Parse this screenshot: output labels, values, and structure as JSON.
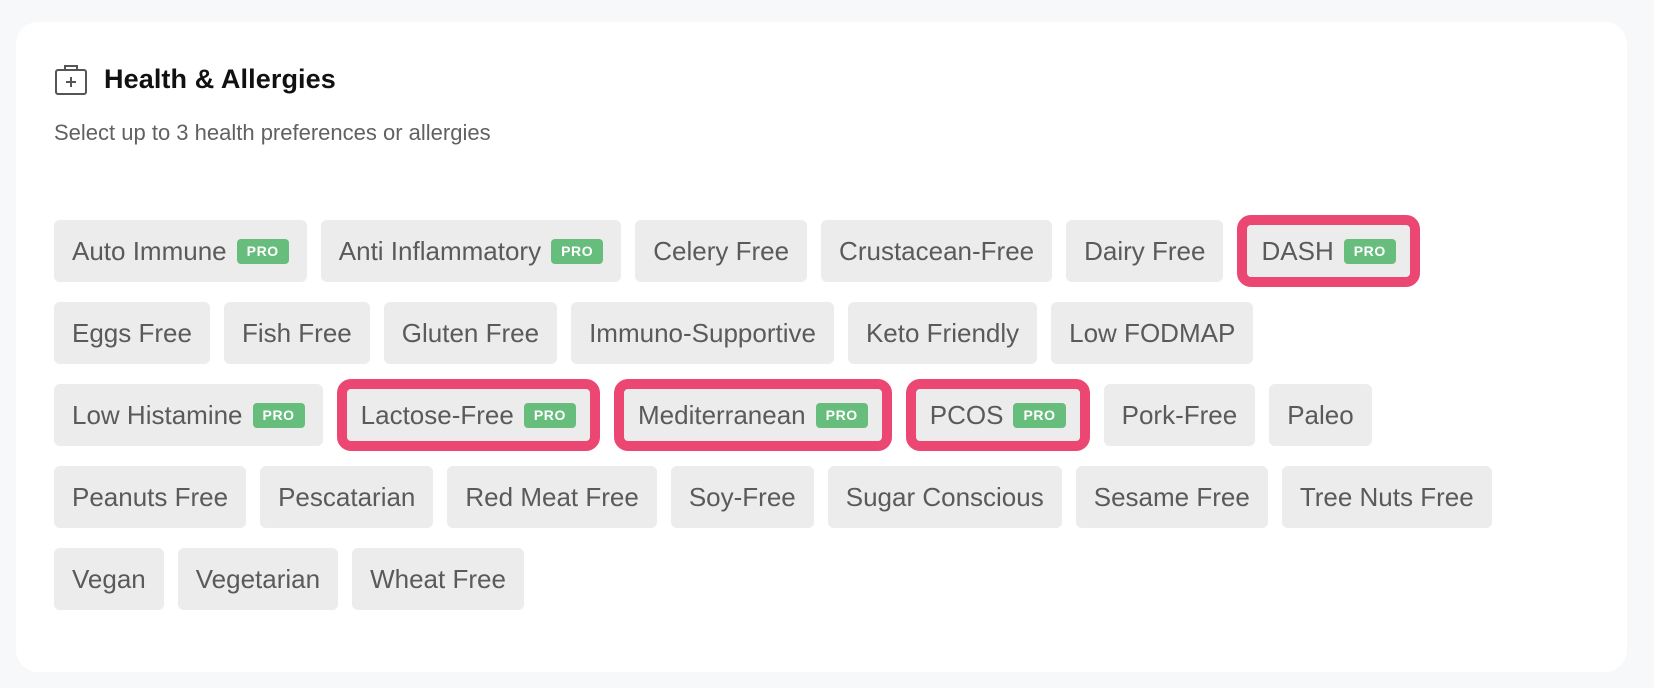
{
  "section": {
    "title": "Health & Allergies",
    "subtitle": "Select up to 3 health preferences or allergies",
    "icon": "medical-kit-icon"
  },
  "colors": {
    "chip_bg": "#ececec",
    "chip_text": "#5a5a5a",
    "pro_badge": "#67bd7c",
    "selected_outline": "#ec4672"
  },
  "rows": [
    [
      {
        "label": "Auto Immune",
        "pro": "PRO",
        "selected": false
      },
      {
        "label": "Anti Inflammatory",
        "pro": "PRO",
        "selected": false
      },
      {
        "label": "Celery Free",
        "pro": null,
        "selected": false
      },
      {
        "label": "Crustacean-Free",
        "pro": null,
        "selected": false
      },
      {
        "label": "Dairy Free",
        "pro": null,
        "selected": false
      },
      {
        "label": "DASH",
        "pro": "PRO",
        "selected": true
      }
    ],
    [
      {
        "label": "Eggs Free",
        "pro": null,
        "selected": false
      },
      {
        "label": "Fish Free",
        "pro": null,
        "selected": false
      },
      {
        "label": "Gluten Free",
        "pro": null,
        "selected": false
      },
      {
        "label": "Immuno-Supportive",
        "pro": null,
        "selected": false
      },
      {
        "label": "Keto Friendly",
        "pro": null,
        "selected": false
      },
      {
        "label": "Low FODMAP",
        "pro": null,
        "selected": false
      }
    ],
    [
      {
        "label": "Low Histamine",
        "pro": "PRO",
        "selected": false
      },
      {
        "label": "Lactose-Free",
        "pro": "PRO",
        "selected": true
      },
      {
        "label": "Mediterranean",
        "pro": "PRO",
        "selected": true
      },
      {
        "label": "PCOS",
        "pro": "PRO",
        "selected": true
      },
      {
        "label": "Pork-Free",
        "pro": null,
        "selected": false
      },
      {
        "label": "Paleo",
        "pro": null,
        "selected": false
      }
    ],
    [
      {
        "label": "Peanuts Free",
        "pro": null,
        "selected": false
      },
      {
        "label": "Pescatarian",
        "pro": null,
        "selected": false
      },
      {
        "label": "Red Meat Free",
        "pro": null,
        "selected": false
      },
      {
        "label": "Soy-Free",
        "pro": null,
        "selected": false
      },
      {
        "label": "Sugar Conscious",
        "pro": null,
        "selected": false
      },
      {
        "label": "Sesame Free",
        "pro": null,
        "selected": false
      },
      {
        "label": "Tree Nuts Free",
        "pro": null,
        "selected": false
      }
    ],
    [
      {
        "label": "Vegan",
        "pro": null,
        "selected": false
      },
      {
        "label": "Vegetarian",
        "pro": null,
        "selected": false
      },
      {
        "label": "Wheat Free",
        "pro": null,
        "selected": false
      }
    ]
  ]
}
